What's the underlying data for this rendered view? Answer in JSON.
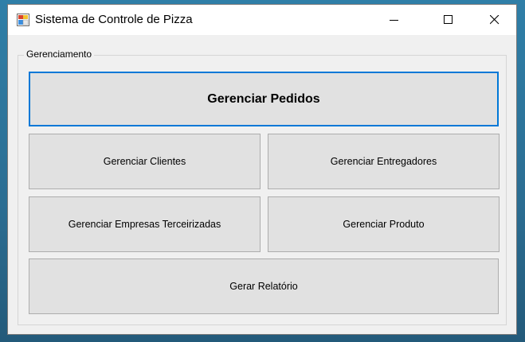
{
  "window": {
    "title": "Sistema de Controle de Pizza",
    "controls": {
      "minimize_icon": "minimize-icon",
      "maximize_icon": "maximize-icon",
      "close_icon": "close-icon"
    }
  },
  "group": {
    "label": "Gerenciamento"
  },
  "buttons": {
    "pedidos": "Gerenciar Pedidos",
    "clientes": "Gerenciar Clientes",
    "entregadores": "Gerenciar Entregadores",
    "empresas": "Gerenciar Empresas Terceirizadas",
    "produto": "Gerenciar Produto",
    "relatorio": "Gerar Relatório"
  },
  "colors": {
    "accent": "#0078d7",
    "button_face": "#e1e1e1",
    "window_bg": "#f0f0f0"
  }
}
